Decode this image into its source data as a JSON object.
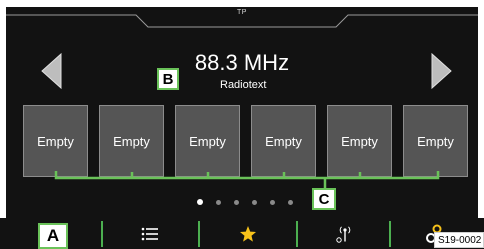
{
  "status_bar": {
    "indicator": "TP"
  },
  "station": {
    "frequency": "88.3 MHz",
    "radiotext": "Radiotext"
  },
  "navigation": {
    "prev_icon": "triangle-left-icon",
    "next_icon": "triangle-right-icon"
  },
  "presets": [
    {
      "label": "Empty"
    },
    {
      "label": "Empty"
    },
    {
      "label": "Empty"
    },
    {
      "label": "Empty"
    },
    {
      "label": "Empty"
    },
    {
      "label": "Empty"
    }
  ],
  "pagination": {
    "pages": 6,
    "current": 1
  },
  "bottom_nav": {
    "items": [
      {
        "icon": "home-icon"
      },
      {
        "icon": "list-icon"
      },
      {
        "icon": "star-icon",
        "color": "#f7c21a"
      },
      {
        "icon": "antenna-icon"
      },
      {
        "icon": "gear-icon",
        "color": "#f7c21a"
      }
    ],
    "separator_color": "#4caf50"
  },
  "callouts": {
    "a": "A",
    "b": "B",
    "c": "C"
  },
  "figure_code": "S19-0002"
}
